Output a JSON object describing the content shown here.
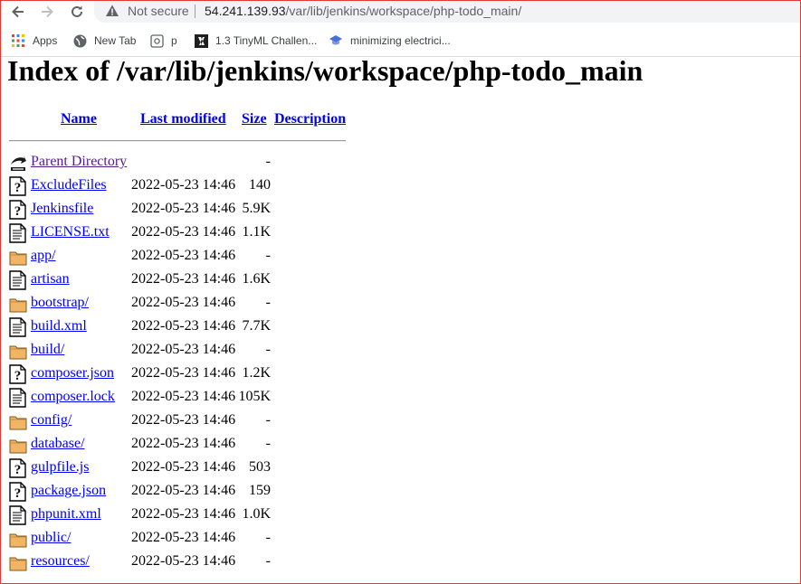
{
  "browser": {
    "security_label": "Not secure",
    "url_host": "54.241.139.93",
    "url_path": "/var/lib/jenkins/workspace/php-todo_main/",
    "bookmarks": [
      {
        "label": "Apps",
        "icon": "apps-grid-icon"
      },
      {
        "label": "New Tab",
        "icon": "globe-icon"
      },
      {
        "label": "p",
        "icon": "page-icon"
      },
      {
        "label": "1.3 TinyML Challen...",
        "icon": "edx-icon"
      },
      {
        "label": "minimizing electrici...",
        "icon": "graduation-cap-icon"
      }
    ]
  },
  "page": {
    "title": "Index of /var/lib/jenkins/workspace/php-todo_main",
    "columns": {
      "name": "Name",
      "last_modified": "Last modified",
      "size": "Size",
      "description": "Description"
    },
    "entries": [
      {
        "name": "Parent Directory",
        "date": "",
        "size": "-",
        "type": "back"
      },
      {
        "name": "ExcludeFiles",
        "date": "2022-05-23 14:46",
        "size": "140",
        "type": "unknown"
      },
      {
        "name": "Jenkinsfile",
        "date": "2022-05-23 14:46",
        "size": "5.9K",
        "type": "unknown"
      },
      {
        "name": "LICENSE.txt",
        "date": "2022-05-23 14:46",
        "size": "1.1K",
        "type": "text"
      },
      {
        "name": "app/",
        "date": "2022-05-23 14:46",
        "size": "-",
        "type": "folder"
      },
      {
        "name": "artisan",
        "date": "2022-05-23 14:46",
        "size": "1.6K",
        "type": "text"
      },
      {
        "name": "bootstrap/",
        "date": "2022-05-23 14:46",
        "size": "-",
        "type": "folder"
      },
      {
        "name": "build.xml",
        "date": "2022-05-23 14:46",
        "size": "7.7K",
        "type": "text"
      },
      {
        "name": "build/",
        "date": "2022-05-23 14:46",
        "size": "-",
        "type": "folder"
      },
      {
        "name": "composer.json",
        "date": "2022-05-23 14:46",
        "size": "1.2K",
        "type": "unknown"
      },
      {
        "name": "composer.lock",
        "date": "2022-05-23 14:46",
        "size": "105K",
        "type": "text"
      },
      {
        "name": "config/",
        "date": "2022-05-23 14:46",
        "size": "-",
        "type": "folder"
      },
      {
        "name": "database/",
        "date": "2022-05-23 14:46",
        "size": "-",
        "type": "folder"
      },
      {
        "name": "gulpfile.js",
        "date": "2022-05-23 14:46",
        "size": "503",
        "type": "unknown"
      },
      {
        "name": "package.json",
        "date": "2022-05-23 14:46",
        "size": "159",
        "type": "unknown"
      },
      {
        "name": "phpunit.xml",
        "date": "2022-05-23 14:46",
        "size": "1.0K",
        "type": "text"
      },
      {
        "name": "public/",
        "date": "2022-05-23 14:46",
        "size": "-",
        "type": "folder"
      },
      {
        "name": "resources/",
        "date": "2022-05-23 14:46",
        "size": "-",
        "type": "folder"
      }
    ]
  },
  "colors": {
    "link": "#0000ee",
    "visited_link": "#551a8b",
    "folder_fill": "#f2b566",
    "omnibox_bg": "#f1f3f4"
  }
}
